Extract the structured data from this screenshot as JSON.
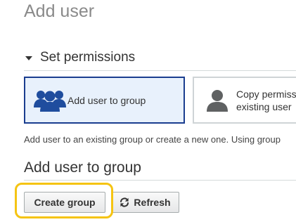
{
  "page": {
    "title": "Add user"
  },
  "permissions": {
    "section_title": "Set permissions",
    "options": [
      {
        "label": "Add user to group",
        "icon": "group-icon",
        "selected": true
      },
      {
        "label_line1": "Copy permiss",
        "label_line2": "existing user",
        "icon": "user-icon",
        "selected": false
      }
    ],
    "description": "Add user to an existing group or create a new one. Using group"
  },
  "group_section": {
    "title": "Add user to group",
    "create_button_label": "Create group",
    "refresh_button_label": "Refresh"
  },
  "colors": {
    "selected_border": "#1a3d8f",
    "selected_background": "#e8f1fc",
    "icon_blue": "#1f4d9e",
    "icon_gray": "#5f6162",
    "highlight": "#f5c413"
  }
}
